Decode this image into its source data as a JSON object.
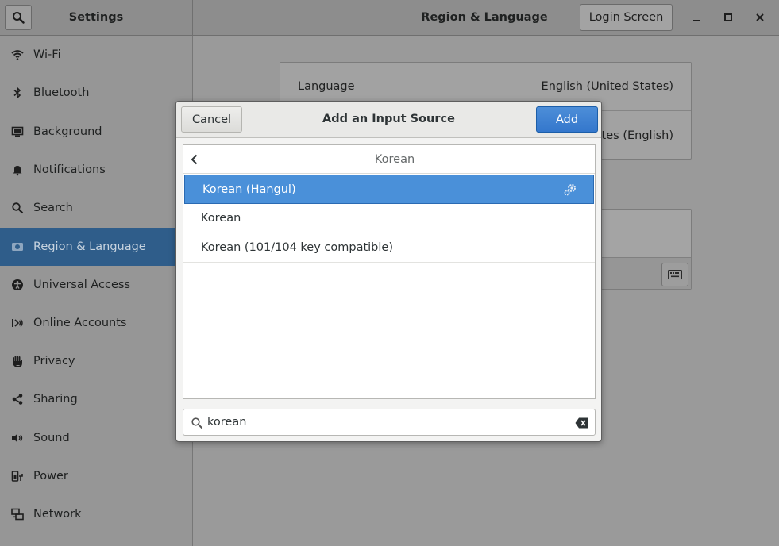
{
  "header": {
    "settings_title": "Settings",
    "page_title": "Region & Language",
    "login_screen_label": "Login Screen",
    "search_icon": "search-icon",
    "minimize_icon": "minimize-icon",
    "maximize_icon": "maximize-icon",
    "close_icon": "close-icon"
  },
  "sidebar": {
    "items": [
      {
        "label": "Wi-Fi",
        "icon": "wifi-icon"
      },
      {
        "label": "Bluetooth",
        "icon": "bluetooth-icon"
      },
      {
        "label": "Background",
        "icon": "background-icon"
      },
      {
        "label": "Notifications",
        "icon": "bell-icon"
      },
      {
        "label": "Search",
        "icon": "search-icon"
      },
      {
        "label": "Region & Language",
        "icon": "region-icon",
        "active": true
      },
      {
        "label": "Universal Access",
        "icon": "accessibility-icon"
      },
      {
        "label": "Online Accounts",
        "icon": "online-accounts-icon"
      },
      {
        "label": "Privacy",
        "icon": "hand-icon"
      },
      {
        "label": "Sharing",
        "icon": "share-icon"
      },
      {
        "label": "Sound",
        "icon": "speaker-icon"
      },
      {
        "label": "Power",
        "icon": "power-icon"
      },
      {
        "label": "Network",
        "icon": "network-icon"
      }
    ]
  },
  "main": {
    "language_label": "Language",
    "language_value": "English (United States)",
    "formats_value_partial": "tates (English)"
  },
  "dialog": {
    "cancel_label": "Cancel",
    "title": "Add an Input Source",
    "add_label": "Add",
    "list_title": "Korean",
    "rows": [
      {
        "label": "Korean (Hangul)",
        "selected": true,
        "has_settings": true
      },
      {
        "label": "Korean",
        "selected": false
      },
      {
        "label": "Korean (101/104 key compatible)",
        "selected": false
      }
    ],
    "search_value": "korean"
  },
  "colors": {
    "accent": "#4a90d9",
    "sidebar_active": "#2f5d8a"
  }
}
